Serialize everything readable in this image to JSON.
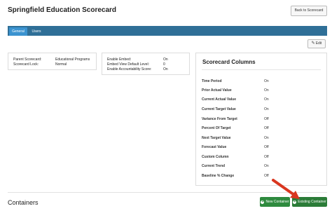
{
  "page": {
    "title": "Springfield Education Scorecard",
    "back_button": "Back to Scorecard"
  },
  "tabs": [
    {
      "label": "General",
      "active": true
    },
    {
      "label": "Users",
      "active": false
    }
  ],
  "edit_button": {
    "label": "Edit",
    "icon": "edit-icon"
  },
  "properties": {
    "parent_label": "Parent Scorecard:",
    "parent_value": "Educational Programs",
    "lock_label": "Scorecard Lock:",
    "lock_value": "Normal"
  },
  "embed": {
    "enable_embed_label": "Enable Embed:",
    "enable_embed_value": "On",
    "default_level_label": "Embed View Default Level:",
    "default_level_value": "0",
    "accountability_label": "Enable Accountability Score:",
    "accountability_value": "On"
  },
  "scorecard_columns": {
    "title": "Scorecard Columns",
    "rows": [
      {
        "label": "Time Period",
        "value": "On"
      },
      {
        "label": "Prior Actual Value",
        "value": "On"
      },
      {
        "label": "Current Actual Value",
        "value": "On"
      },
      {
        "label": "Current Target Value",
        "value": "On"
      },
      {
        "label": "Variance From Target",
        "value": "Off"
      },
      {
        "label": "Percent Of Target",
        "value": "Off"
      },
      {
        "label": "Next Target Value",
        "value": "On"
      },
      {
        "label": "Forecast Value",
        "value": "Off"
      },
      {
        "label": "Custom Column",
        "value": "Off"
      },
      {
        "label": "Current Trend",
        "value": "On"
      },
      {
        "label": "Baseline % Change",
        "value": "Off"
      }
    ]
  },
  "containers": {
    "title": "Containers",
    "new_button": "New Container",
    "existing_button": "Existing Container"
  },
  "colors": {
    "tab_bar": "#2f6f97",
    "tab_active": "#3b93d0",
    "button_green": "#2e8a3e",
    "annotation_arrow": "#d9361f"
  }
}
